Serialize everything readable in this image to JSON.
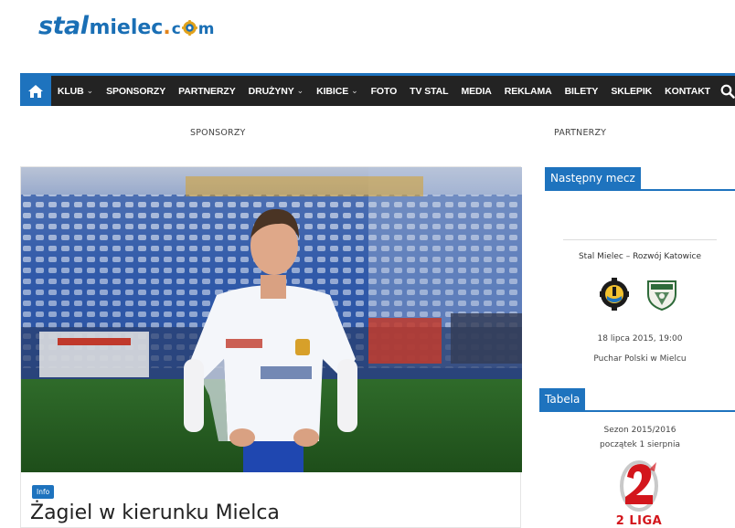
{
  "logo": {
    "part1": "stal",
    "part2": "mielec",
    "part3": ".",
    "part4": "c",
    "part5": "m"
  },
  "nav": {
    "home_icon": "home-icon",
    "items": [
      {
        "label": "KLUB",
        "dropdown": true
      },
      {
        "label": "SPONSORZY",
        "dropdown": false
      },
      {
        "label": "PARTNERZY",
        "dropdown": false
      },
      {
        "label": "DRUŻYNY",
        "dropdown": true
      },
      {
        "label": "KIBICE",
        "dropdown": true
      },
      {
        "label": "FOTO",
        "dropdown": false
      },
      {
        "label": "TV STAL",
        "dropdown": false
      },
      {
        "label": "MEDIA",
        "dropdown": false
      },
      {
        "label": "REKLAMA",
        "dropdown": false
      },
      {
        "label": "BILETY",
        "dropdown": false
      },
      {
        "label": "SKLEPIK",
        "dropdown": false
      },
      {
        "label": "KONTAKT",
        "dropdown": false
      }
    ],
    "caret": "⌄",
    "search_icon": "search-icon"
  },
  "secondary": {
    "left": "SPONSORZY",
    "right": "PARTNERZY"
  },
  "article": {
    "category": "Info",
    "title": "Żagiel w kierunku Mielca"
  },
  "sidebar": {
    "next_match": {
      "heading": "Następny mecz",
      "teams": "Stal Mielec – Rozwój Katowice",
      "date": "18 lipca 2015, 19:00",
      "venue": "Puchar Polski w Mielcu"
    },
    "table": {
      "heading": "Tabela",
      "season": "Sezon 2015/2016",
      "start": "początek 1 sierpnia",
      "league_label": "2 LIGA"
    }
  },
  "colors": {
    "brand": "#1e73be",
    "nav_bg": "#232323",
    "logo_blue": "#1a6fb5",
    "logo_orange": "#e2841b",
    "league_red": "#d3161c"
  }
}
